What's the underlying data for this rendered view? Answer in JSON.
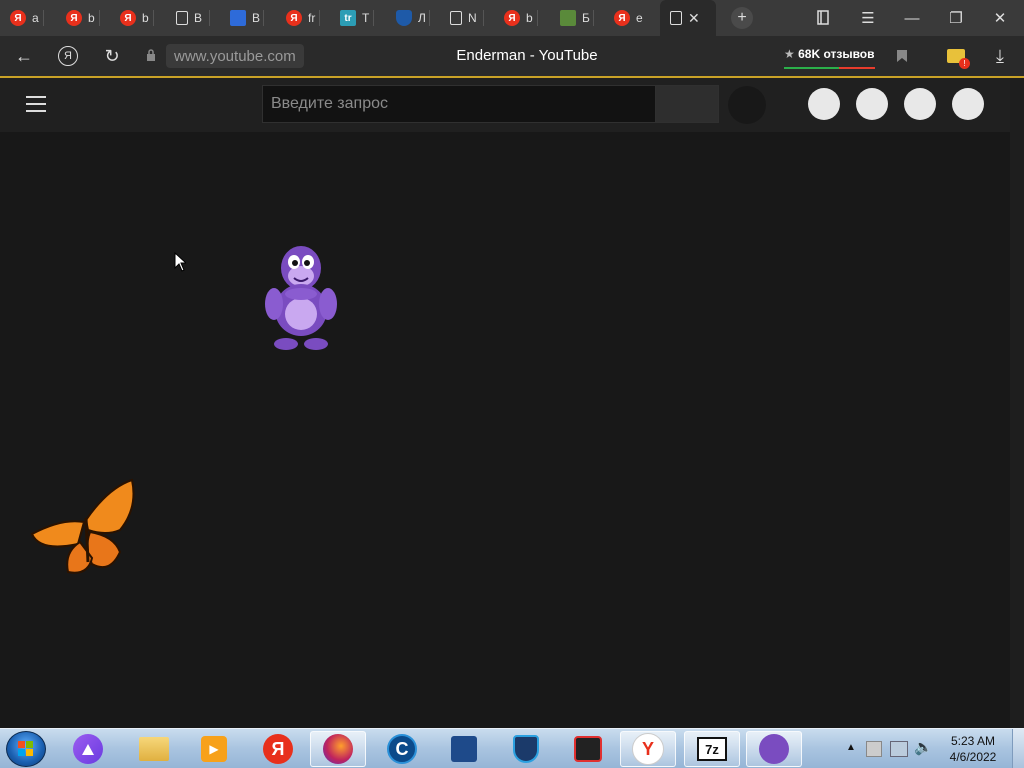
{
  "browser": {
    "tabs": [
      {
        "icon": "yandex-icon",
        "label": "a"
      },
      {
        "icon": "yandex-icon",
        "label": "b"
      },
      {
        "icon": "yandex-icon",
        "label": "b"
      },
      {
        "icon": "document-icon",
        "label": "B"
      },
      {
        "icon": "grid-app-icon",
        "label": "B"
      },
      {
        "icon": "yandex-icon",
        "label": "fr"
      },
      {
        "icon": "tr-icon",
        "label": "T"
      },
      {
        "icon": "shield-icon",
        "label": "Л"
      },
      {
        "icon": "document-icon",
        "label": "N"
      },
      {
        "icon": "yandex-icon",
        "label": "b"
      },
      {
        "icon": "kaspersky-icon",
        "label": "Б"
      },
      {
        "icon": "yandex-icon",
        "label": "e"
      },
      {
        "icon": "document-icon",
        "label": ""
      }
    ],
    "address_bar": {
      "url": "www.youtube.com",
      "page_title": "Enderman - YouTube",
      "reviews": "68K отзывов",
      "notification_count": "!"
    }
  },
  "youtube": {
    "search_placeholder": "Введите запрос"
  },
  "taskbar": {
    "apps": [
      "folder-icon",
      "media-player-icon",
      "yandex-browser-icon",
      "firefox-icon",
      "ccleaner-icon",
      "photo-app-icon",
      "shield-vpn-icon",
      "screen-recorder-icon",
      "yandex-app-icon",
      "7zip-icon",
      "bonzi-icon"
    ],
    "clock_time": "5:23 AM",
    "clock_date": "4/6/2022"
  },
  "colors": {
    "accent": "#c9a227",
    "yandex_red": "#e8301c",
    "background": "#181818"
  }
}
